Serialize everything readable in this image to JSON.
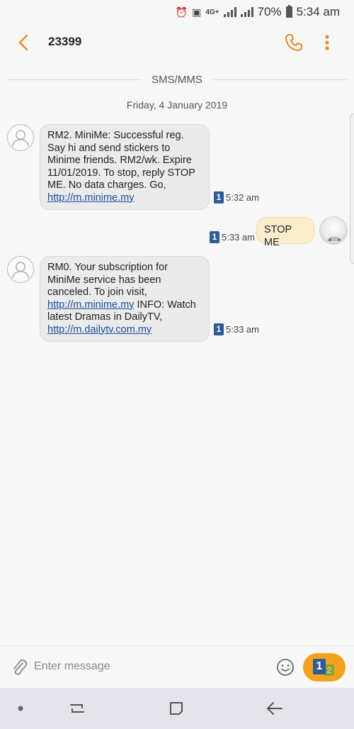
{
  "status_bar": {
    "network": "4G+",
    "battery": "70%",
    "time": "5:34 am"
  },
  "header": {
    "title": "23399"
  },
  "thread": {
    "channel_label": "SMS/MMS",
    "date_label": "Friday, 4 January 2019"
  },
  "messages": [
    {
      "direction": "incoming",
      "text": "RM2. MiniMe: Successful reg. Say hi and send stickers to Minime friends. RM2/wk. Expire 11/01/2019. To stop, reply STOP ME. No data charges. Go,",
      "link": "http://m.minime.my",
      "sim": "1",
      "time": "5:32 am"
    },
    {
      "direction": "outgoing",
      "text": "STOP ME",
      "sim": "1",
      "time": "5:33 am"
    },
    {
      "direction": "incoming",
      "text_before": "RM0. Your subscription for MiniMe service has been canceled. To join visit,",
      "link1": "http://m.minime.my",
      "text_mid": "INFO: Watch latest Dramas in DailyTV,",
      "link2": "http://m.dailytv.com.my",
      "sim": "1",
      "time": "5:33 am"
    }
  ],
  "composer": {
    "placeholder": "Enter message",
    "send_sim_primary": "1",
    "send_sim_secondary": "2"
  },
  "colors": {
    "accent": "#f4a21e",
    "sim_badge": "#2e5b96",
    "incoming_bubble": "#ebebeb",
    "outgoing_bubble": "#fbeecd",
    "link": "#1a4fa0"
  }
}
